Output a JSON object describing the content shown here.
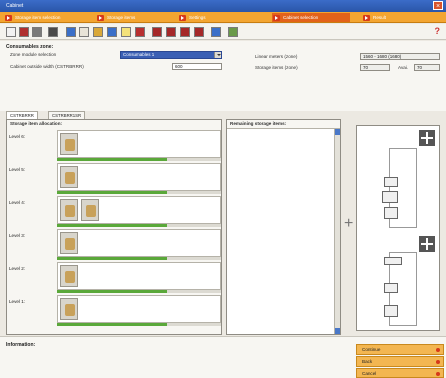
{
  "window": {
    "title": "Cabinet"
  },
  "tabs": [
    {
      "label": "Storage item selection"
    },
    {
      "label": "Storage items"
    },
    {
      "label": "Settings"
    },
    {
      "label": "Cabinet selection"
    },
    {
      "label": "Result"
    }
  ],
  "form": {
    "section_title": "Consumables zone:",
    "zone_label": "Zone module selection",
    "zone_value": "Consumables 1",
    "width_label": "Cabinet outside width (CSTRBRRR)",
    "width_value": "600",
    "linear_label": "Linear meters (zone)",
    "linear_value": "1560 - 1680 (1680)",
    "storage_label": "Storage items (zone)",
    "storage_value": "70",
    "avail_label": "Avai.",
    "avail_value": "70"
  },
  "subtabs": [
    {
      "label": "CSTRBRRR"
    },
    {
      "label": "CSTRBRR1SR"
    }
  ],
  "allocation": {
    "title": "Storage item allocation:",
    "levels": [
      {
        "label": "Level 6:",
        "items": 1,
        "fill_pct": 67
      },
      {
        "label": "Level 5:",
        "items": 1,
        "fill_pct": 67
      },
      {
        "label": "Level 4:",
        "items": 2,
        "fill_pct": 67
      },
      {
        "label": "Level 3:",
        "items": 1,
        "fill_pct": 67
      },
      {
        "label": "Level 2:",
        "items": 1,
        "fill_pct": 67
      },
      {
        "label": "Level 1:",
        "items": 1,
        "fill_pct": 67
      }
    ]
  },
  "remaining": {
    "title": "Remaining storage items:"
  },
  "info": {
    "label": "Information:"
  },
  "buttons": {
    "continue": "Continue",
    "back": "Back",
    "cancel": "Cancel"
  },
  "icons": [
    "help-icon",
    "cabinet-add-icon",
    "storage-item-icon"
  ],
  "colors": {
    "accent": "#f3a531",
    "active_tab": "#e2621a",
    "fill": "#5aa83a",
    "title_bar": "#2a55a8"
  }
}
